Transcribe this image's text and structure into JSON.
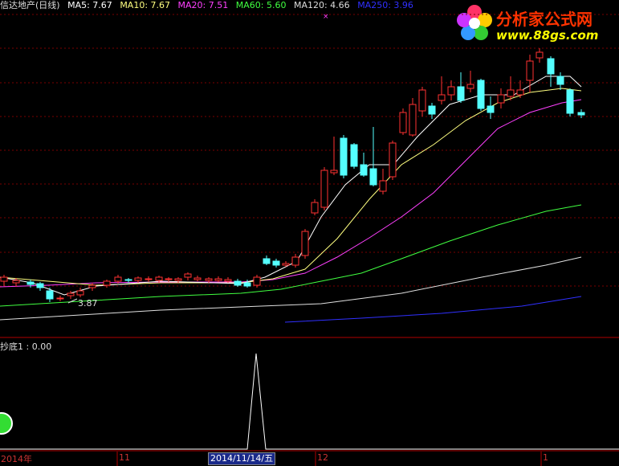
{
  "main_header": {
    "title": "信达地产(日线)",
    "ma5": "MA5: 7.67",
    "ma10": "MA10: 7.67",
    "ma20": "MA20: 7.51",
    "ma60": "MA60: 5.60",
    "ma120": "MA120: 4.66",
    "ma250": "MA250: 3.96"
  },
  "indicator_header": "抄底1 : 0.00",
  "low_label": "3.87",
  "axis": {
    "year": "2014年",
    "nov": "11",
    "selected_date": "2014/11/14/五",
    "dec": "12",
    "jan": "1"
  },
  "logo": {
    "name": "分析家公式网",
    "url": "www.88gs.com"
  },
  "colors": {
    "up": "#ff3232",
    "down": "#54ffff",
    "ma5": "#ffffff",
    "ma10": "#ffff80",
    "ma20": "#ff40ff",
    "ma60": "#40ff40",
    "ma120": "#e0e0e0",
    "ma250": "#3030ff",
    "grid": "#7a0000"
  }
}
